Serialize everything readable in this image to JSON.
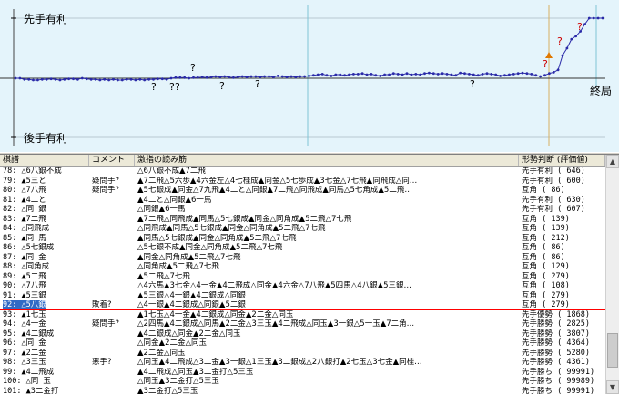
{
  "graph": {
    "sente_label": "先手有利",
    "gote_label": "後手有利",
    "end_label": "終局",
    "question_mark": "?",
    "eval_points": [
      0,
      0,
      -2,
      -2,
      -3,
      -3,
      -2,
      -2,
      -1,
      -2,
      -3,
      -2,
      -1,
      -1,
      -2,
      0,
      -1,
      -2,
      -2,
      -3,
      -2,
      -3,
      -2,
      -3,
      -3,
      -2,
      -2,
      -3,
      -2,
      -3,
      -2,
      -2,
      -1,
      -1,
      -2,
      0,
      1,
      1,
      1,
      0,
      1,
      1,
      2,
      1,
      2,
      3,
      2,
      3,
      2,
      1,
      2,
      3,
      2,
      3,
      3,
      2,
      3,
      3,
      2,
      4,
      3,
      2,
      3,
      2,
      3,
      3,
      4,
      5,
      6,
      7,
      5,
      4,
      6,
      6,
      5,
      6,
      7,
      7,
      8,
      6,
      7,
      5,
      4,
      6,
      6,
      8,
      7,
      6,
      8,
      6,
      7,
      6,
      8,
      9,
      8,
      7,
      8,
      7,
      6,
      5,
      9,
      8,
      7,
      6,
      5,
      7,
      8,
      7,
      6,
      4,
      5,
      6,
      7,
      8,
      9,
      8,
      7,
      5,
      3,
      5,
      8,
      10,
      14,
      38,
      50,
      65,
      70,
      78,
      90,
      100,
      100,
      100,
      100
    ]
  },
  "header": {
    "col_move": "棋譜",
    "col_comment": "コメント",
    "col_reading": "激指の読み筋",
    "col_eval": "形勢判断 (評価値)"
  },
  "rows": [
    {
      "move": "78: △6八銀不成",
      "comment": "",
      "reading": "△6八銀不成▲7二飛",
      "eval": "先手有利 (   646)"
    },
    {
      "move": "79: ▲5三と",
      "comment": "疑問手?",
      "reading": "▲7二飛△5六歩▲4六金左△4七桂成▲同金△5七歩成▲3七金△7七飛▲同飛成△同…",
      "eval": "先手有利 (   600)"
    },
    {
      "move": "80: △7八飛",
      "comment": "疑問手?",
      "reading": "▲5七銀成▲同金△7九飛▲4二と△同銀▲7二飛△同飛成▲同馬△5七角成▲5二飛…",
      "eval": "互角     (    86)"
    },
    {
      "move": "81: ▲4二と",
      "comment": "",
      "reading": "▲4二と△同銀▲6一馬",
      "eval": "先手有利 (   630)"
    },
    {
      "move": "82: △同 銀",
      "comment": "",
      "reading": "△同銀▲6一馬",
      "eval": "先手有利 (   607)"
    },
    {
      "move": "83: ▲7二飛",
      "comment": "",
      "reading": "▲7二飛△同飛成▲同馬△5七銀成▲同金△同角成▲5二飛△7七飛",
      "eval": "互角     (   139)"
    },
    {
      "move": "84: △同飛成",
      "comment": "",
      "reading": "△同飛成▲同馬△5七銀成▲同金△同角成▲5二飛△7七飛",
      "eval": "互角     (   139)"
    },
    {
      "move": "85: ▲同 馬",
      "comment": "",
      "reading": "▲同馬△5七銀成▲同金△同角成▲5二飛△7七飛",
      "eval": "互角     (   212)"
    },
    {
      "move": "86: △5七銀成",
      "comment": "",
      "reading": "△5七銀不成▲同金△同角成▲5二飛△7七飛",
      "eval": "互角     (    86)"
    },
    {
      "move": "87: ▲同 金",
      "comment": "",
      "reading": "▲同金△同角成▲5二飛△7七飛",
      "eval": "互角     (    86)"
    },
    {
      "move": "88: △同角成",
      "comment": "",
      "reading": "△同角成▲5二飛△7七飛",
      "eval": "互角     (   129)"
    },
    {
      "move": "89: ▲5二飛",
      "comment": "",
      "reading": "▲5二飛△7七飛",
      "eval": "互角     (   279)"
    },
    {
      "move": "90: △7八飛",
      "comment": "",
      "reading": "△4六馬▲3七金△4一金▲4二飛成△同金▲4六金△7八飛▲5四馬△4八銀▲5三銀…",
      "eval": "互角     (   108)"
    },
    {
      "move": "91: ▲5三銀",
      "comment": "",
      "reading": "▲5三銀△4一銀▲4二銀成△同銀",
      "eval": "互角     (   279)"
    },
    {
      "move": "92: △5八銀",
      "comment": "敗着?",
      "reading": "△4一銀▲4二銀成△同銀▲5二銀",
      "eval": "互角     (   279)",
      "selected": true
    },
    {
      "move": "93: ▲1七玉",
      "comment": "",
      "reading": "▲1七玉△4一金▲4二銀成△同金▲2二金△同玉",
      "eval": "先手優勢 (  1868)"
    },
    {
      "move": "94: △4一金",
      "comment": "疑問手?",
      "reading": "△2四馬▲4二銀成△同馬▲2二金△3三玉▲4二飛成△同玉▲3一銀△5一玉▲7二角…",
      "eval": "先手勝勢 (  2825)"
    },
    {
      "move": "95: ▲4二銀成",
      "comment": "",
      "reading": "▲4二銀成△同金▲2二金△同玉",
      "eval": "先手勝勢 (  3807)"
    },
    {
      "move": "96: △同 金",
      "comment": "",
      "reading": "△同金▲2二金△同玉",
      "eval": "先手勝勢 (  4364)"
    },
    {
      "move": "97: ▲2二金",
      "comment": "",
      "reading": "▲2二金△同玉",
      "eval": "先手勝勢 (  5280)"
    },
    {
      "move": "98: △3三玉",
      "comment": "悪手?",
      "reading": "△同玉▲4二飛成△3二金▲3一銀△1三玉▲3二銀成△2八銀打▲2七玉△3七金▲同桂…",
      "eval": "先手勝勢 (  4361)"
    },
    {
      "move": "99: ▲4二飛成",
      "comment": "",
      "reading": "▲4二飛成△同玉▲3二金打△5三玉",
      "eval": "先手勝ち ( 99991)"
    },
    {
      "move": "100: △同 玉",
      "comment": "",
      "reading": "△同玉▲3二金打△5三玉",
      "eval": "先手勝ち ( 99989)"
    },
    {
      "move": "101: ▲3二金打",
      "comment": "",
      "reading": "▲3二金打△5三玉",
      "eval": "先手勝ち ( 99991)"
    }
  ]
}
